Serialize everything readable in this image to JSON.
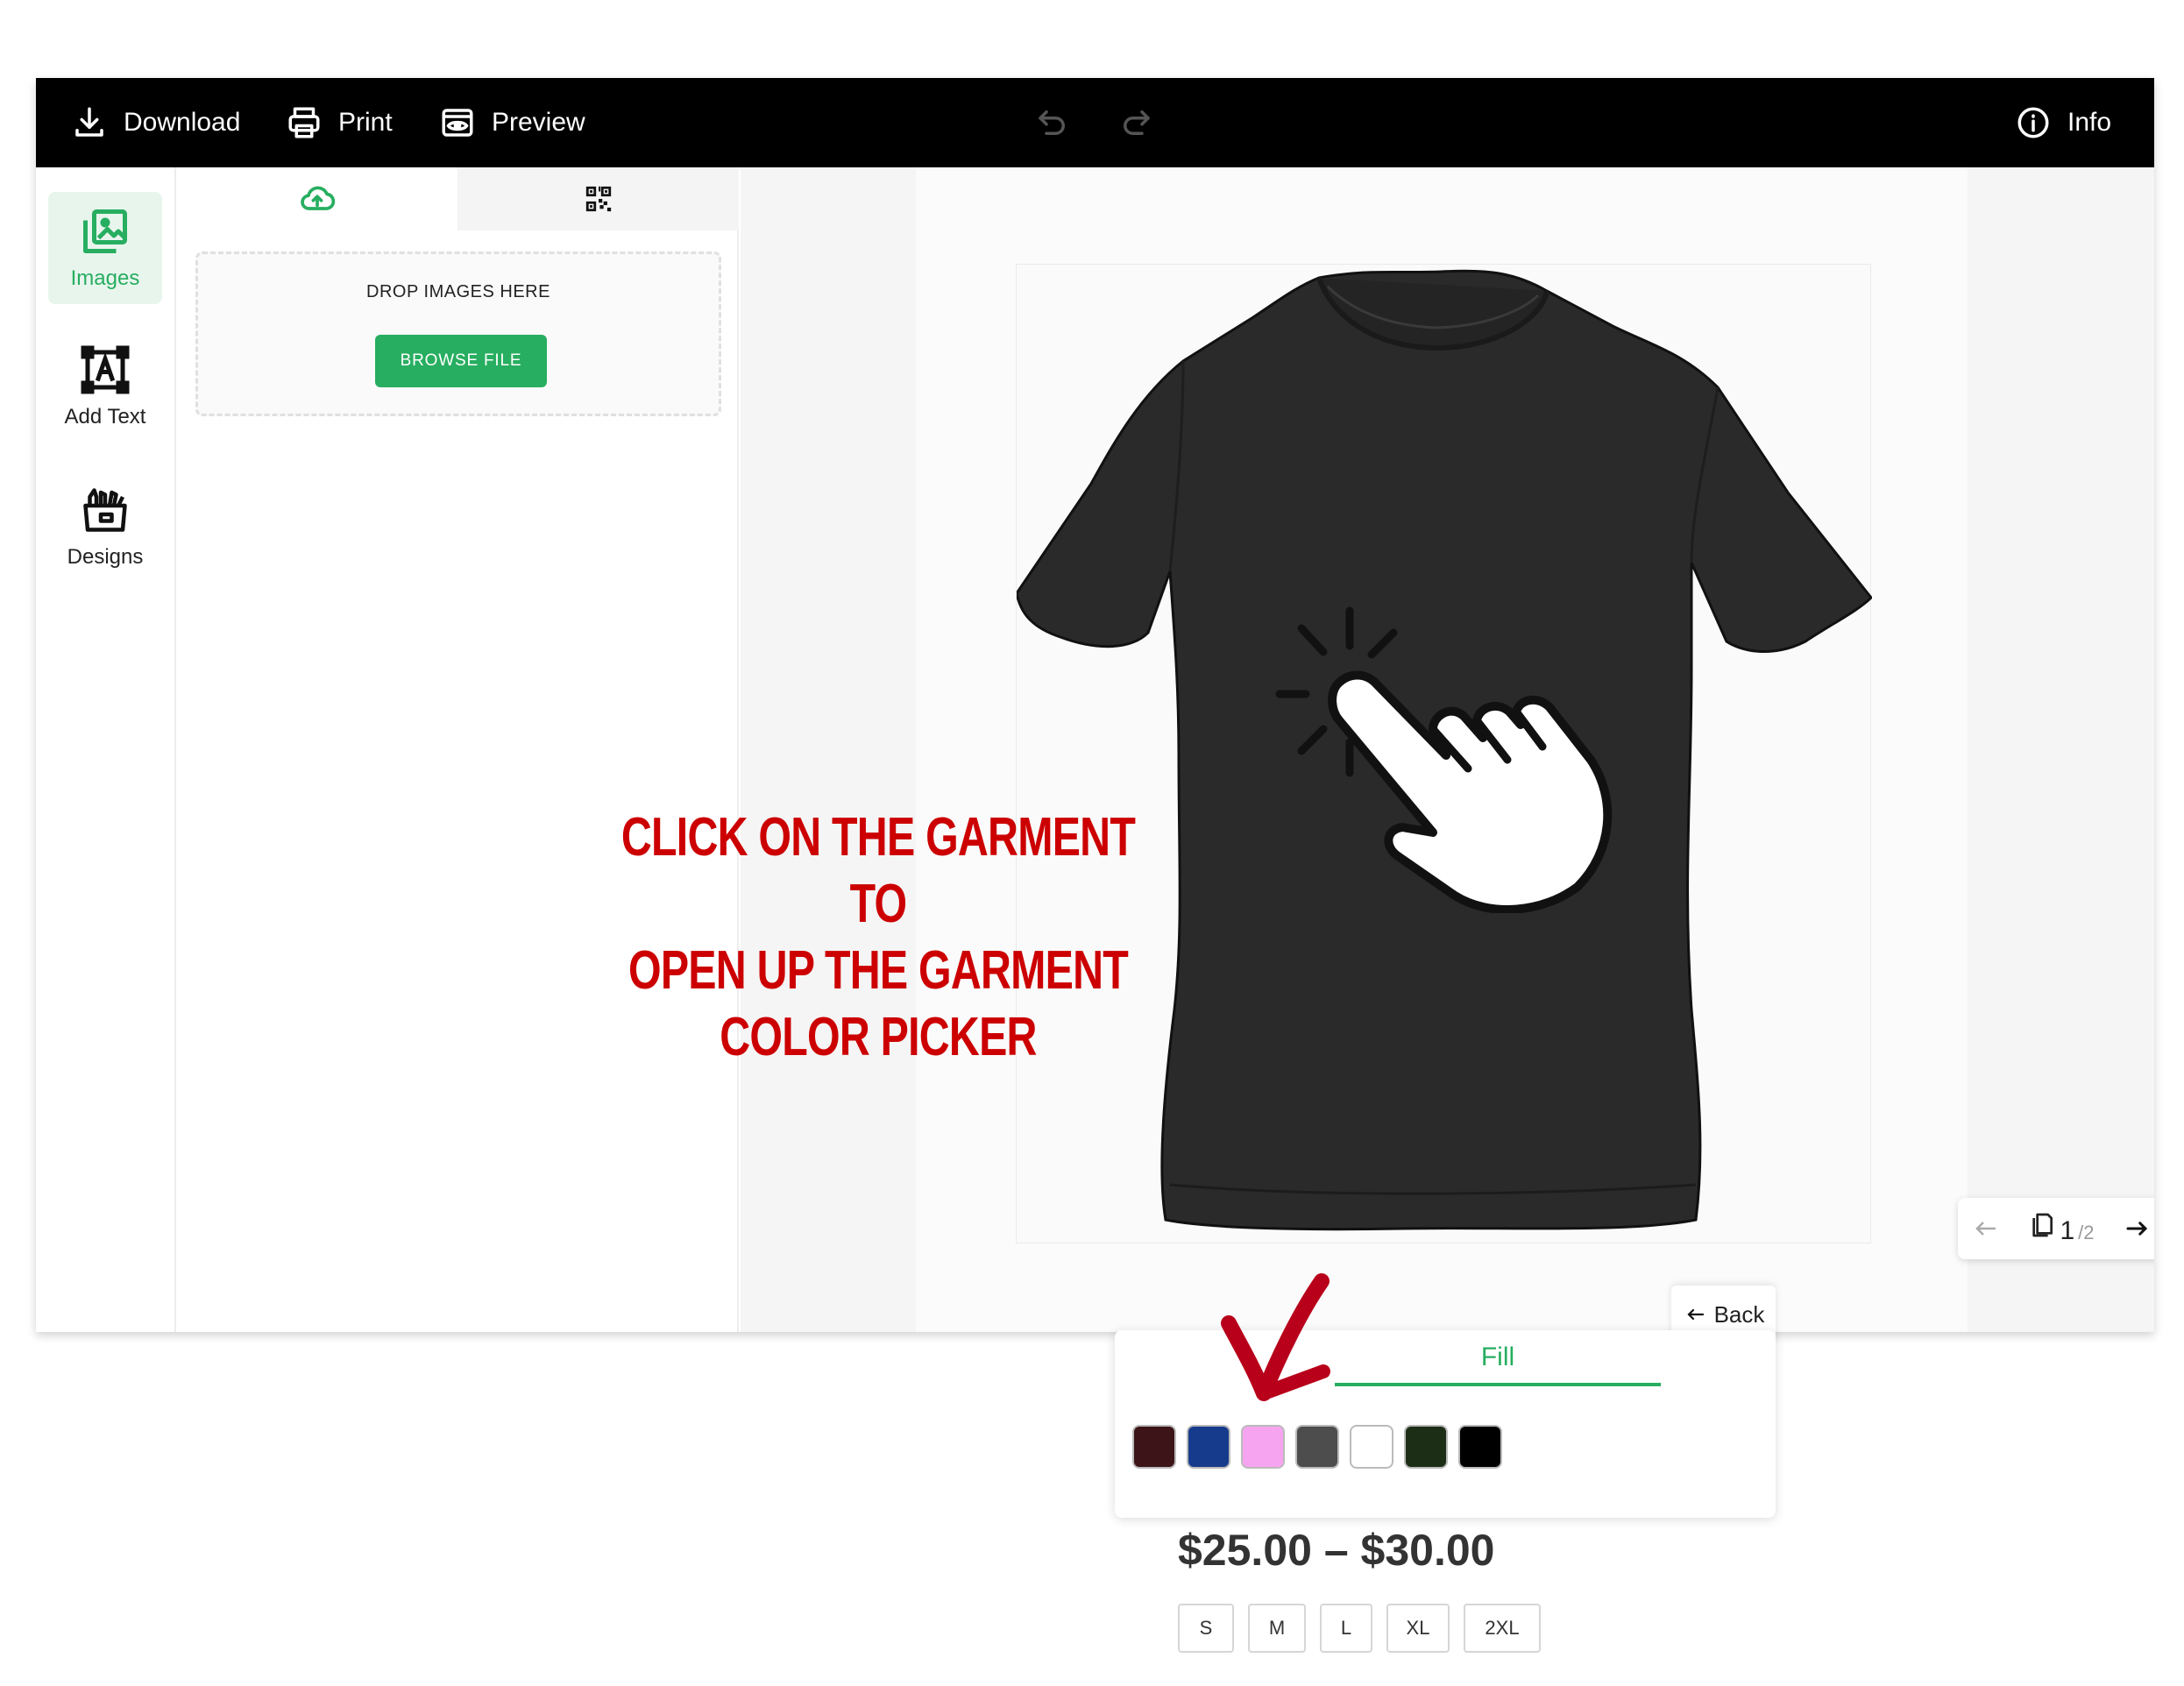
{
  "toolbar": {
    "download_label": "Download",
    "print_label": "Print",
    "preview_label": "Preview",
    "info_label": "Info"
  },
  "sidebar": {
    "items": [
      {
        "label": "Images",
        "icon": "images-icon",
        "active": true
      },
      {
        "label": "Add Text",
        "icon": "add-text-icon",
        "active": false
      },
      {
        "label": "Designs",
        "icon": "designs-icon",
        "active": false
      }
    ]
  },
  "upload_panel": {
    "tabs": [
      "upload-cloud-icon",
      "qr-code-icon"
    ],
    "drop_label": "DROP IMAGES HERE",
    "browse_label": "BROWSE FILE"
  },
  "annotation": {
    "line1": "CLICK ON THE GARMENT TO",
    "line2": "OPEN UP THE GARMENT",
    "line3": "COLOR PICKER"
  },
  "pager": {
    "current": "1",
    "total": "/2"
  },
  "picker": {
    "back_label": "Back",
    "tab_label": "Fill",
    "swatches": [
      "#3d1418",
      "#173b8c",
      "#f7a4f0",
      "#4d4d4d",
      "#ffffff",
      "#1d2e16",
      "#000000"
    ]
  },
  "product": {
    "price": "$25.00 – $30.00",
    "sizes": [
      "S",
      "M",
      "L",
      "XL",
      "2XL"
    ]
  },
  "colors": {
    "accent": "#27ae60",
    "annotation": "#cc0000",
    "toolbar_bg": "#000000"
  }
}
